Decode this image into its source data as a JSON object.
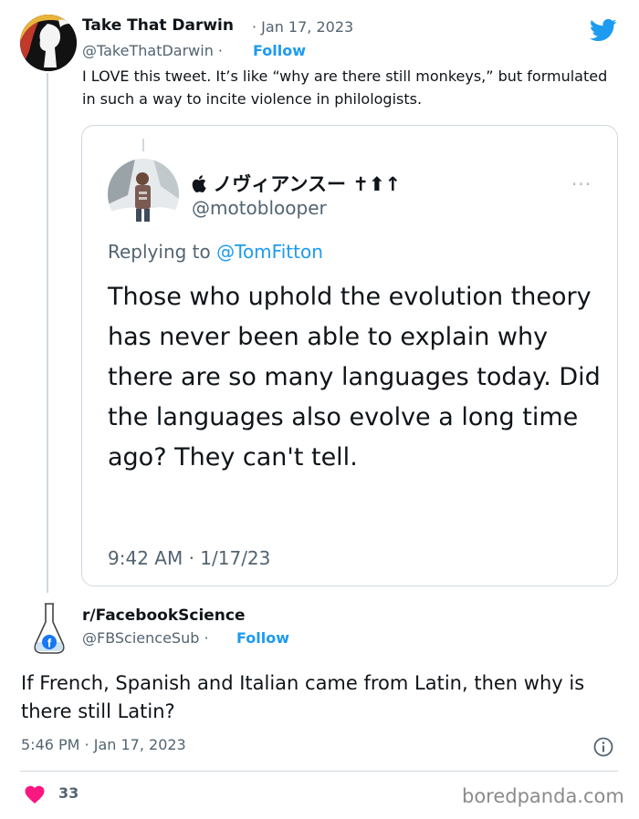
{
  "tweet": {
    "author_name": "Take That Darwin",
    "date": "· Jan 17, 2023",
    "handle": "@TakeThatDarwin ·",
    "follow_label": "Follow",
    "text": "I LOVE this tweet. It’s like “why are there still monkeys,” but formulated in such a way to incite violence in philologists."
  },
  "embedded": {
    "author_name": " ノヴィアンスー ✝︎⬆︎↑",
    "handle": "@motoblooper",
    "more_label": "···",
    "replying_prefix": "Replying to ",
    "replying_mention": "@TomFitton",
    "text": "Those who uphold the evolution theory has never been able to explain why there are so many languages today. Did the languages also evolve a long time ago? They can't tell.",
    "time": "9:42 AM · 1/17/23"
  },
  "reply": {
    "author_name": "r/FacebookScience",
    "handle": "@FBScienceSub ·",
    "follow_label": "Follow",
    "text": "If French, Spanish and Italian came from Latin, then why is there still Latin?",
    "time": "5:46 PM · Jan 17, 2023",
    "likes": "33"
  },
  "watermark": "boredpanda.com",
  "colors": {
    "accent": "#1d9bf0",
    "muted": "#536471",
    "like": "#f91880",
    "border": "#cfd9de"
  },
  "icons": {
    "platform": "twitter-bird-icon",
    "info": "info-icon",
    "like": "heart-icon",
    "brand": "apple-logo-icon"
  }
}
